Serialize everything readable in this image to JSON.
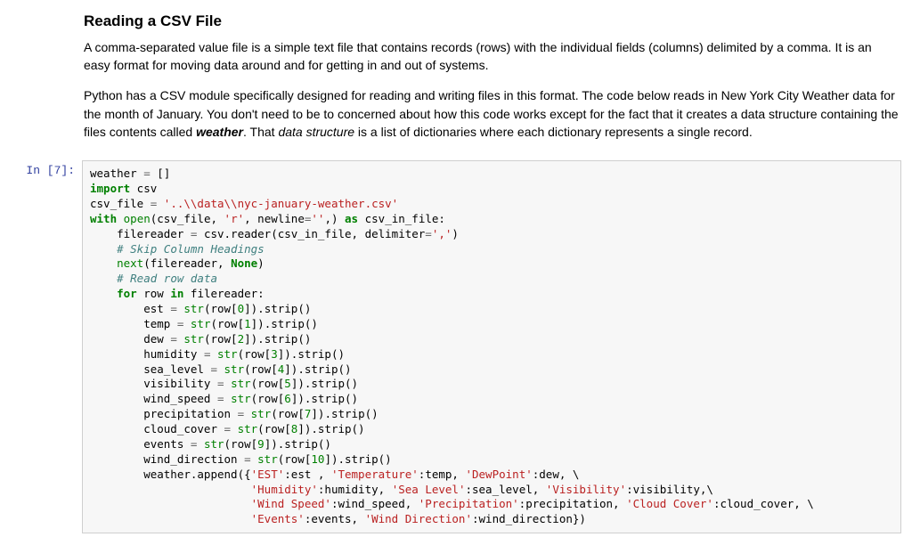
{
  "text": {
    "heading": "Reading a CSV File",
    "para1": "A comma-separated value file is a simple text file that contains records (rows) with the individual fields (columns) delimited by a comma. It is an easy format for moving data around and for getting in and out of systems.",
    "para2_a": "Python has a CSV module specifically designed for reading and writing files in this format. The code below reads in New York City Weather data for the month of January. You don't need to be to concerned about how this code works except for the fact that it creates a data structure containing the files contents called ",
    "para2_b_bold": "weather",
    "para2_c": ". That ",
    "para2_d_ital": "data structure",
    "para2_e": " is a list of dictionaries where each dictionary represents a single record."
  },
  "code": {
    "prompt": "In [7]:",
    "tokens": [
      [
        "n",
        "weather "
      ],
      [
        "op",
        "="
      ],
      [
        "n",
        " []"
      ],
      [
        "br",
        ""
      ],
      [
        "k",
        "import"
      ],
      [
        "n",
        " csv"
      ],
      [
        "br",
        ""
      ],
      [
        "n",
        "csv_file "
      ],
      [
        "op",
        "="
      ],
      [
        "n",
        " "
      ],
      [
        "s",
        "'..\\\\data\\\\nyc-january-weather.csv'"
      ],
      [
        "br",
        ""
      ],
      [
        "k",
        "with"
      ],
      [
        "n",
        " "
      ],
      [
        "nb",
        "open"
      ],
      [
        "n",
        "(csv_file, "
      ],
      [
        "s",
        "'r'"
      ],
      [
        "n",
        ", newline"
      ],
      [
        "op",
        "="
      ],
      [
        "s",
        "''"
      ],
      [
        "n",
        ",) "
      ],
      [
        "k",
        "as"
      ],
      [
        "n",
        " csv_in_file:"
      ],
      [
        "br",
        ""
      ],
      [
        "n",
        "    filereader "
      ],
      [
        "op",
        "="
      ],
      [
        "n",
        " csv.reader(csv_in_file, delimiter"
      ],
      [
        "op",
        "="
      ],
      [
        "s",
        "','"
      ],
      [
        "n",
        ")"
      ],
      [
        "br",
        ""
      ],
      [
        "n",
        "    "
      ],
      [
        "c",
        "# Skip Column Headings"
      ],
      [
        "br",
        ""
      ],
      [
        "n",
        "    "
      ],
      [
        "nb",
        "next"
      ],
      [
        "n",
        "(filereader, "
      ],
      [
        "kc",
        "None"
      ],
      [
        "n",
        ")"
      ],
      [
        "br",
        ""
      ],
      [
        "n",
        "    "
      ],
      [
        "c",
        "# Read row data"
      ],
      [
        "br",
        ""
      ],
      [
        "n",
        "    "
      ],
      [
        "k",
        "for"
      ],
      [
        "n",
        " row "
      ],
      [
        "k",
        "in"
      ],
      [
        "n",
        " filereader:"
      ],
      [
        "br",
        ""
      ],
      [
        "n",
        "        est "
      ],
      [
        "op",
        "="
      ],
      [
        "n",
        " "
      ],
      [
        "nb",
        "str"
      ],
      [
        "n",
        "(row["
      ],
      [
        "num",
        "0"
      ],
      [
        "n",
        "]).strip()"
      ],
      [
        "br",
        ""
      ],
      [
        "n",
        "        temp "
      ],
      [
        "op",
        "="
      ],
      [
        "n",
        " "
      ],
      [
        "nb",
        "str"
      ],
      [
        "n",
        "(row["
      ],
      [
        "num",
        "1"
      ],
      [
        "n",
        "]).strip()"
      ],
      [
        "br",
        ""
      ],
      [
        "n",
        "        dew "
      ],
      [
        "op",
        "="
      ],
      [
        "n",
        " "
      ],
      [
        "nb",
        "str"
      ],
      [
        "n",
        "(row["
      ],
      [
        "num",
        "2"
      ],
      [
        "n",
        "]).strip()"
      ],
      [
        "br",
        ""
      ],
      [
        "n",
        "        humidity "
      ],
      [
        "op",
        "="
      ],
      [
        "n",
        " "
      ],
      [
        "nb",
        "str"
      ],
      [
        "n",
        "(row["
      ],
      [
        "num",
        "3"
      ],
      [
        "n",
        "]).strip()"
      ],
      [
        "br",
        ""
      ],
      [
        "n",
        "        sea_level "
      ],
      [
        "op",
        "="
      ],
      [
        "n",
        " "
      ],
      [
        "nb",
        "str"
      ],
      [
        "n",
        "(row["
      ],
      [
        "num",
        "4"
      ],
      [
        "n",
        "]).strip()"
      ],
      [
        "br",
        ""
      ],
      [
        "n",
        "        visibility "
      ],
      [
        "op",
        "="
      ],
      [
        "n",
        " "
      ],
      [
        "nb",
        "str"
      ],
      [
        "n",
        "(row["
      ],
      [
        "num",
        "5"
      ],
      [
        "n",
        "]).strip()"
      ],
      [
        "br",
        ""
      ],
      [
        "n",
        "        wind_speed "
      ],
      [
        "op",
        "="
      ],
      [
        "n",
        " "
      ],
      [
        "nb",
        "str"
      ],
      [
        "n",
        "(row["
      ],
      [
        "num",
        "6"
      ],
      [
        "n",
        "]).strip()"
      ],
      [
        "br",
        ""
      ],
      [
        "n",
        "        precipitation "
      ],
      [
        "op",
        "="
      ],
      [
        "n",
        " "
      ],
      [
        "nb",
        "str"
      ],
      [
        "n",
        "(row["
      ],
      [
        "num",
        "7"
      ],
      [
        "n",
        "]).strip()"
      ],
      [
        "br",
        ""
      ],
      [
        "n",
        "        cloud_cover "
      ],
      [
        "op",
        "="
      ],
      [
        "n",
        " "
      ],
      [
        "nb",
        "str"
      ],
      [
        "n",
        "(row["
      ],
      [
        "num",
        "8"
      ],
      [
        "n",
        "]).strip()"
      ],
      [
        "br",
        ""
      ],
      [
        "n",
        "        events "
      ],
      [
        "op",
        "="
      ],
      [
        "n",
        " "
      ],
      [
        "nb",
        "str"
      ],
      [
        "n",
        "(row["
      ],
      [
        "num",
        "9"
      ],
      [
        "n",
        "]).strip()"
      ],
      [
        "br",
        ""
      ],
      [
        "n",
        "        wind_direction "
      ],
      [
        "op",
        "="
      ],
      [
        "n",
        " "
      ],
      [
        "nb",
        "str"
      ],
      [
        "n",
        "(row["
      ],
      [
        "num",
        "10"
      ],
      [
        "n",
        "]).strip()"
      ],
      [
        "br",
        ""
      ],
      [
        "n",
        "        weather.append({"
      ],
      [
        "s",
        "'EST'"
      ],
      [
        "n",
        ":est , "
      ],
      [
        "s",
        "'Temperature'"
      ],
      [
        "n",
        ":temp, "
      ],
      [
        "s",
        "'DewPoint'"
      ],
      [
        "n",
        ":dew, \\"
      ],
      [
        "br",
        ""
      ],
      [
        "n",
        "                        "
      ],
      [
        "s",
        "'Humidity'"
      ],
      [
        "n",
        ":humidity, "
      ],
      [
        "s",
        "'Sea Level'"
      ],
      [
        "n",
        ":sea_level, "
      ],
      [
        "s",
        "'Visibility'"
      ],
      [
        "n",
        ":visibility,\\"
      ],
      [
        "br",
        ""
      ],
      [
        "n",
        "                        "
      ],
      [
        "s",
        "'Wind Speed'"
      ],
      [
        "n",
        ":wind_speed, "
      ],
      [
        "s",
        "'Precipitation'"
      ],
      [
        "n",
        ":precipitation, "
      ],
      [
        "s",
        "'Cloud Cover'"
      ],
      [
        "n",
        ":cloud_cover, \\"
      ],
      [
        "br",
        ""
      ],
      [
        "n",
        "                        "
      ],
      [
        "s",
        "'Events'"
      ],
      [
        "n",
        ":events, "
      ],
      [
        "s",
        "'Wind Direction'"
      ],
      [
        "n",
        ":wind_direction})"
      ]
    ]
  }
}
